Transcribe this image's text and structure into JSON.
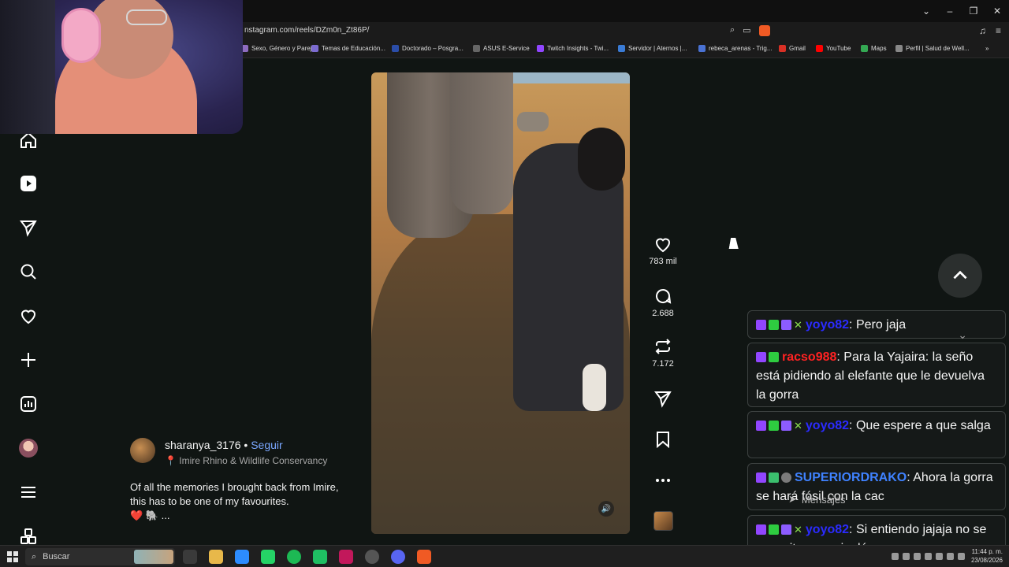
{
  "browser": {
    "url": "nstagram.com/reels/DZm0n_Zt86P/",
    "bookmarks": [
      {
        "label": "Sexo, Género y Parej...",
        "color": "#8e6cc0"
      },
      {
        "label": "Temas de Educación...",
        "color": "#7c6bd0"
      },
      {
        "label": "Doctorado – Posgra...",
        "color": "#2b4da8"
      },
      {
        "label": "ASUS E-Service",
        "color": "#666666"
      },
      {
        "label": "Twitch Insights - Twi...",
        "color": "#9146ff"
      },
      {
        "label": "Servidor | Aternos |...",
        "color": "#3a7bd5"
      },
      {
        "label": "rebeca_arenas - Trig...",
        "color": "#4a72d4"
      },
      {
        "label": "Gmail",
        "color": "#d93025"
      },
      {
        "label": "YouTube",
        "color": "#ff0000"
      },
      {
        "label": "Maps",
        "color": "#34a853"
      },
      {
        "label": "Perfil | Salud de Well...",
        "color": "#888888"
      }
    ]
  },
  "post": {
    "likes": "783 mil",
    "comments": "2.688",
    "reposts": "7.172",
    "author": "sharanya_3176",
    "separator": " • ",
    "follow_label": "Seguir",
    "location": "Imire Rhino & Wildlife Conservancy",
    "caption": "Of all the memories I brought back from Imire, this has to be one of my favourites.",
    "caption_tail": "❤️ 🐘 ..."
  },
  "chat": {
    "messages": [
      {
        "user": "yoyo82",
        "user_color": "#2b2bff",
        "text": ": Pero jaja"
      },
      {
        "user": "racso988",
        "user_color": "#ff2222",
        "text": ": Para la Yajaira: la seño está pidiendo al elefante que le devuelva la gorra"
      },
      {
        "user": "yoyo82",
        "user_color": "#2b2bff",
        "text": ": Que espere a que salga"
      },
      {
        "user": "SUPERIORDRAKO",
        "user_color": "#3f82ff",
        "text": ": Ahora la gorra se hará fósil con la cac"
      },
      {
        "user": "yoyo82",
        "user_color": "#2b2bff",
        "text": ": Si entiendo jajaja no se necesita saver inglés"
      }
    ],
    "mensajes_label": "Mensajes"
  },
  "taskbar": {
    "search_label": "Buscar",
    "time": "11:44 p. m.",
    "date": "23/08/2026"
  },
  "icons": [
    "home-icon",
    "reels-icon",
    "explore-icon",
    "search-icon",
    "heart-icon",
    "create-icon",
    "stats-icon",
    "profile-avatar",
    "menu-icon",
    "apps-icon"
  ]
}
